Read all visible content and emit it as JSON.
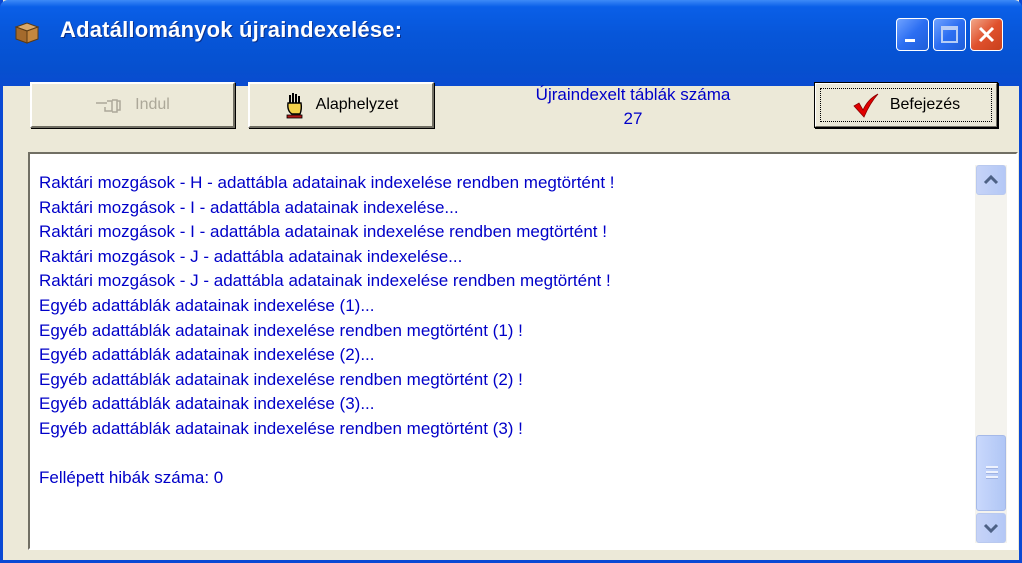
{
  "window": {
    "title": "Adatállományok újraindexelése:",
    "icons": {
      "app": "package-icon",
      "minimize": "minimize-icon",
      "maximize": "maximize-icon",
      "close": "close-icon"
    }
  },
  "toolbar": {
    "start_label": "Indul",
    "start_icon": "pointing-hand-icon",
    "reset_label": "Alaphelyzet",
    "reset_icon": "hand-stop-icon",
    "finish_label": "Befejezés",
    "finish_icon": "checkmark-icon"
  },
  "counter": {
    "label": "Újraindexelt táblák száma",
    "value": "27"
  },
  "log": {
    "lines": [
      "Raktári mozgások - H - adattábla adatainak indexelése rendben megtörtént !",
      "Raktári mozgások - I - adattábla adatainak indexelése...",
      "Raktári mozgások - I - adattábla adatainak indexelése rendben megtörtént !",
      "Raktári mozgások - J - adattábla adatainak indexelése...",
      "Raktári mozgások - J - adattábla adatainak indexelése rendben megtörtént !",
      "Egyéb adattáblák adatainak indexelése (1)...",
      "Egyéb adattáblák adatainak indexelése rendben megtörtént (1) !",
      "Egyéb adattáblák adatainak indexelése (2)...",
      "Egyéb adattáblák adatainak indexelése rendben megtörtént (2) !",
      "Egyéb adattáblák adatainak indexelése (3)...",
      "Egyéb adattáblák adatainak indexelése rendben megtörtént (3) !"
    ],
    "errors_line": "Fellépett hibák száma: 0"
  },
  "colors": {
    "log_text": "#0000c8",
    "titlebar": "#0756d9",
    "face": "#ece9d8",
    "check": "#e00000"
  }
}
